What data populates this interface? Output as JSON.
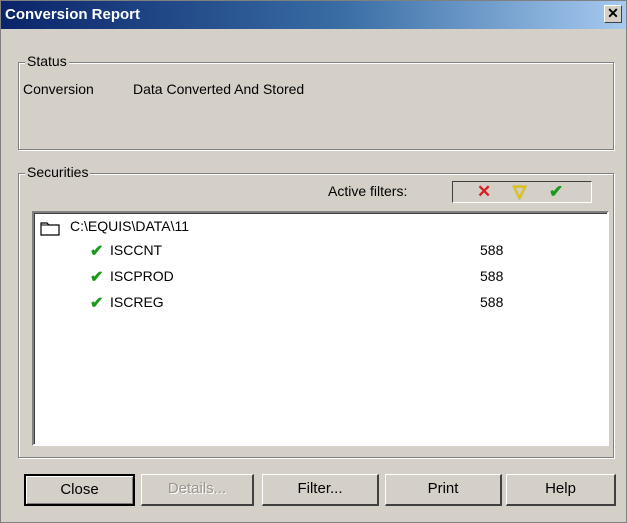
{
  "window": {
    "title": "Conversion Report",
    "close_glyph": "✕"
  },
  "status": {
    "legend": "Status",
    "key": "Conversion",
    "value": "Data Converted And Stored"
  },
  "securities": {
    "legend": "Securities",
    "active_filters_label": "Active filters:",
    "filter_icons": [
      {
        "icon": "x-icon",
        "glyph": "✕",
        "color": "#d81e1e"
      },
      {
        "icon": "triangle-down-icon",
        "glyph": "▽",
        "color": "#e6c800"
      },
      {
        "icon": "check-icon",
        "glyph": "✔",
        "color": "#1a9a1a"
      }
    ],
    "folder": {
      "path": "C:\\EQUIS\\DATA\\11"
    },
    "items": [
      {
        "name": "ISCCNT",
        "count": "588",
        "status_icon": "check-icon"
      },
      {
        "name": "ISCPROD",
        "count": "588",
        "status_icon": "check-icon"
      },
      {
        "name": "ISCREG",
        "count": "588",
        "status_icon": "check-icon"
      }
    ]
  },
  "buttons": {
    "close": "Close",
    "details": "Details...",
    "filter": "Filter...",
    "print": "Print",
    "help": "Help"
  }
}
